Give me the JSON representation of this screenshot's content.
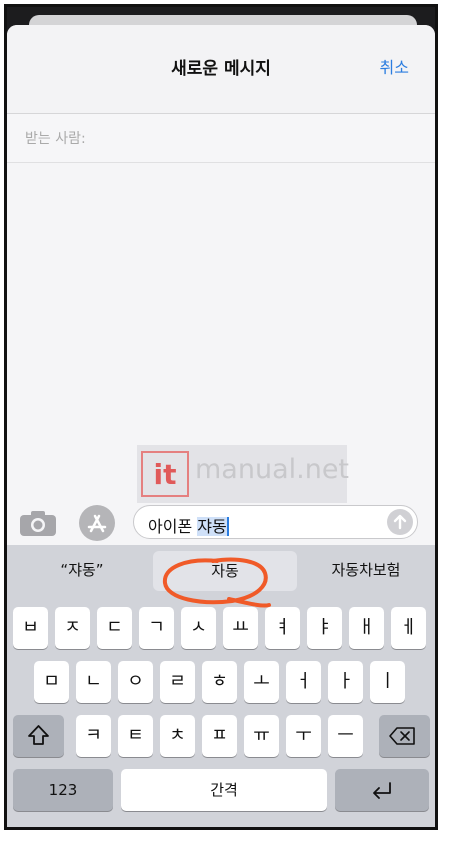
{
  "header": {
    "title": "새로운 메시지",
    "cancel_label": "취소"
  },
  "recipients": {
    "label": "받는 사람:"
  },
  "watermark": {
    "badge": "it",
    "text": "manual.net"
  },
  "compose": {
    "text_before": "아이폰 ",
    "text_selected": "쟈동"
  },
  "suggestions": [
    "“쟈동”",
    "자동",
    "자동차보험"
  ],
  "keyboard": {
    "row1": [
      "ㅂ",
      "ㅈ",
      "ㄷ",
      "ㄱ",
      "ㅅ",
      "ㅛ",
      "ㅕ",
      "ㅑ",
      "ㅐ",
      "ㅔ"
    ],
    "row2": [
      "ㅁ",
      "ㄴ",
      "ㅇ",
      "ㄹ",
      "ㅎ",
      "ㅗ",
      "ㅓ",
      "ㅏ",
      "ㅣ"
    ],
    "row3": [
      "ㅋ",
      "ㅌ",
      "ㅊ",
      "ㅍ",
      "ㅠ",
      "ㅜ",
      "ㅡ"
    ],
    "numbers_label": "123",
    "space_label": "간격"
  },
  "colors": {
    "accent": "#2b7de0",
    "annotation": "#f05a28"
  }
}
